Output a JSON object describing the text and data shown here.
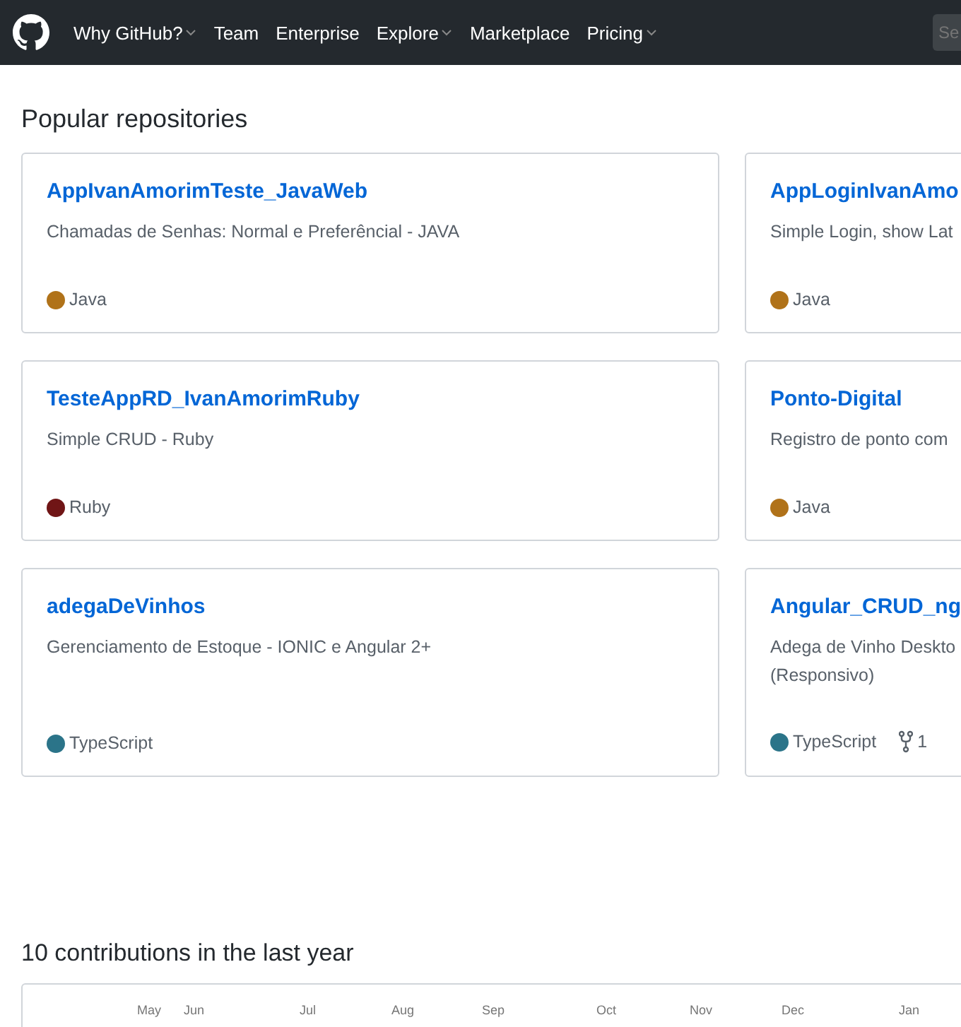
{
  "header": {
    "nav": [
      {
        "label": "Why GitHub?",
        "dropdown": true
      },
      {
        "label": "Team",
        "dropdown": false
      },
      {
        "label": "Enterprise",
        "dropdown": false
      },
      {
        "label": "Explore",
        "dropdown": true
      },
      {
        "label": "Marketplace",
        "dropdown": false
      },
      {
        "label": "Pricing",
        "dropdown": true
      }
    ],
    "search": {
      "placeholder": "Se"
    }
  },
  "popular": {
    "title": "Popular repositories",
    "repos": [
      {
        "name": "AppIvanAmorimTeste_JavaWeb",
        "description": "Chamadas de Senhas: Normal e Preferêncial - JAVA",
        "language": "Java",
        "color": "#b07219"
      },
      {
        "name": "AppLoginIvanAmo",
        "description": "Simple Login, show Lat",
        "language": "Java",
        "color": "#b07219"
      },
      {
        "name": "TesteAppRD_IvanAmorimRuby",
        "description": "Simple CRUD - Ruby",
        "language": "Ruby",
        "color": "#701516"
      },
      {
        "name": "Ponto-Digital",
        "description": "Registro de ponto com",
        "language": "Java",
        "color": "#b07219"
      },
      {
        "name": "adegaDeVinhos",
        "description": "Gerenciamento de Estoque - IONIC e Angular 2+",
        "language": "TypeScript",
        "color": "#2b7489"
      },
      {
        "name": "Angular_CRUD_ng",
        "description": "Adega de Vinho Deskto\n(Responsivo)",
        "language": "TypeScript",
        "color": "#2b7489",
        "forks": "1"
      }
    ]
  },
  "contributions": {
    "title": "10 contributions in the last year",
    "months": [
      "May",
      "Jun",
      "Jul",
      "Aug",
      "Sep",
      "Oct",
      "Nov",
      "Dec",
      "Jan"
    ]
  }
}
